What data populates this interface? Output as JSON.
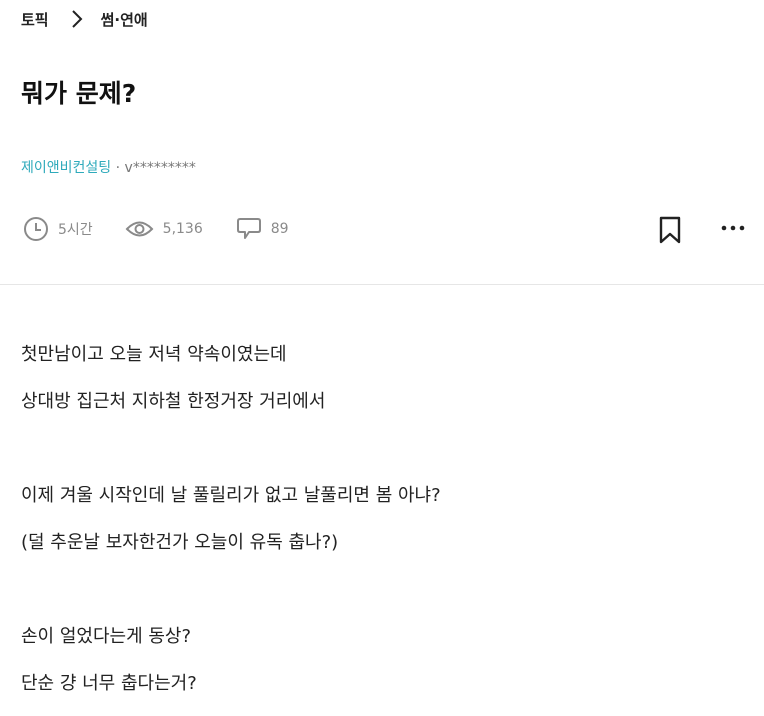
{
  "breadcrumb": {
    "root": "토픽",
    "current": "썸·연애"
  },
  "post": {
    "title": "뭐가 문제?",
    "company": "제이앤비컨설팅",
    "author_separator": " · ",
    "author_id": "v*********",
    "time_ago": "5시간",
    "views": "5,136",
    "comments": "89"
  },
  "icons": {
    "breadcrumb_separator": "chevron-right-icon",
    "time": "clock-icon",
    "views": "eye-icon",
    "comments": "speech-bubble-icon",
    "bookmark": "bookmark-icon",
    "more": "more-horizontal-icon"
  },
  "colors": {
    "company": "#2eaabb",
    "meta": "#8a8a8a",
    "text": "#222222"
  },
  "content": [
    "첫만남이고 오늘 저녁 약속이였는데",
    "상대방 집근처 지하철 한정거장 거리에서",
    "",
    "이제 겨울 시작인데 날 풀릴리가 없고 날풀리면 봄 아냐?",
    "(덜 추운날 보자한건가 오늘이 유독 춥나?)",
    "",
    "손이 얼었다는게 동상?",
    "단순 걍 너무 춥다는거?"
  ]
}
